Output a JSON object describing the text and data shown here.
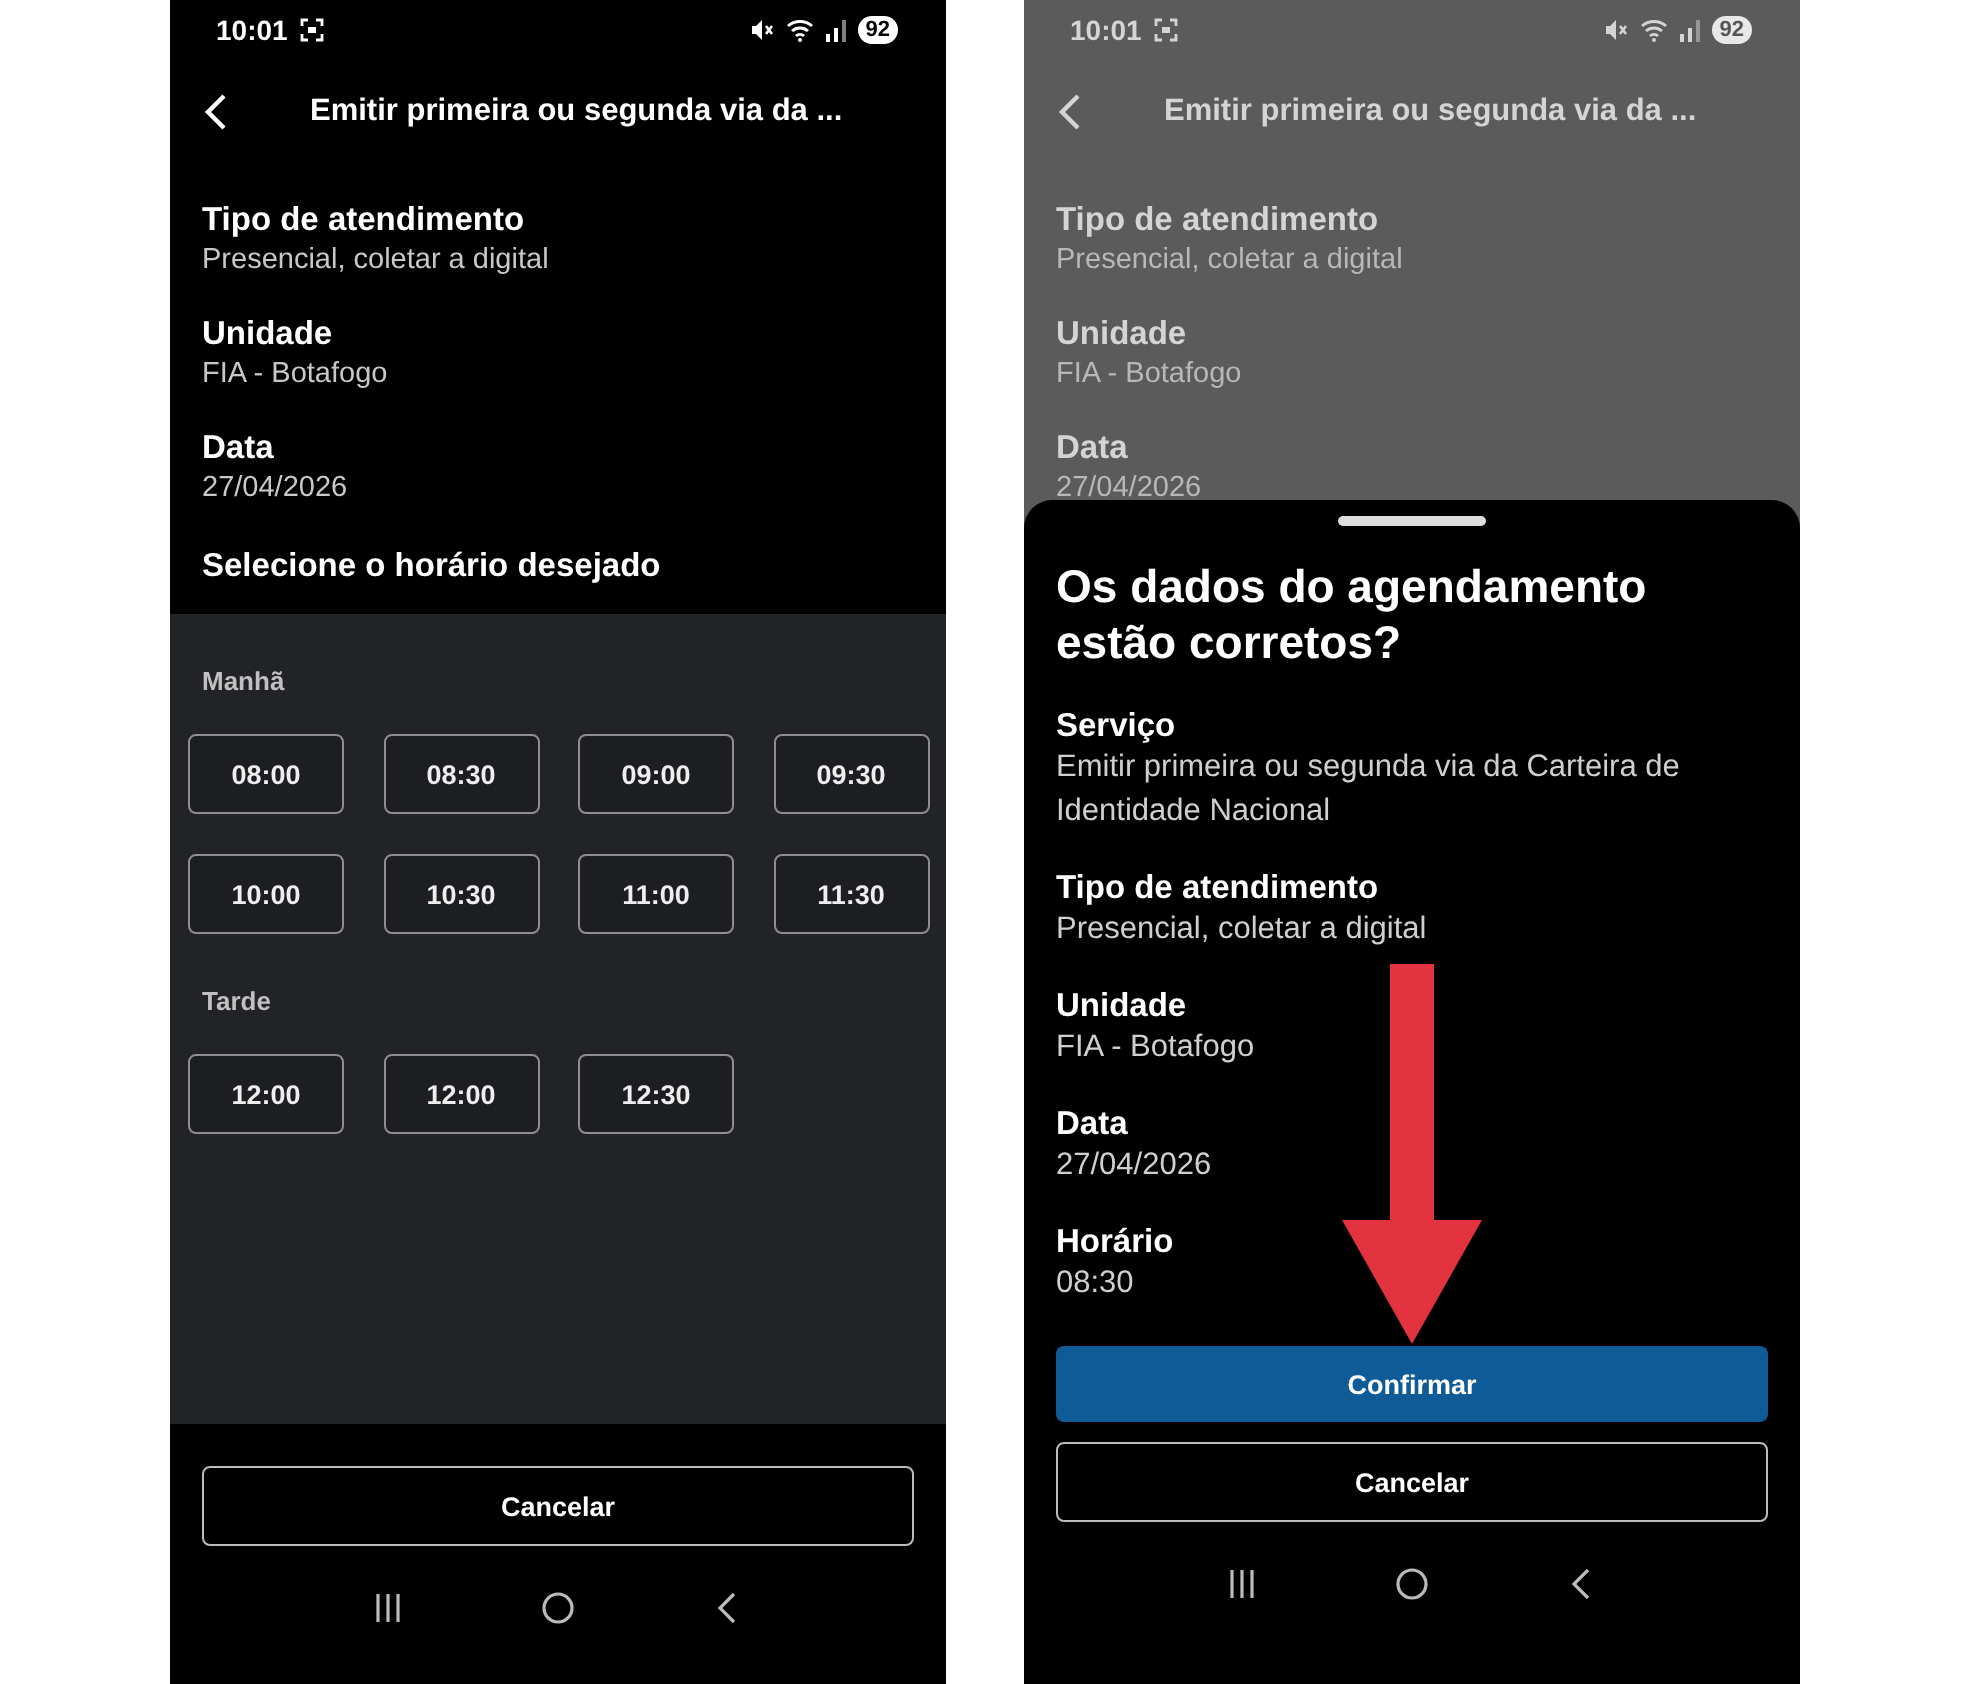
{
  "screens": [
    {
      "kind": "slots",
      "dimmed": false,
      "status_bar": {
        "time": "10:01",
        "battery": "92"
      },
      "header": {
        "title": "Emitir primeira ou segunda via da ..."
      },
      "fields": [
        {
          "label": "Tipo de atendimento",
          "value": "Presencial, coletar a digital"
        },
        {
          "label": "Unidade",
          "value": "FIA - Botafogo"
        },
        {
          "label": "Data",
          "value": "27/04/2026"
        }
      ],
      "prompt": "Selecione o horário desejado",
      "periods": [
        {
          "label": "Manhã",
          "slots": [
            "08:00",
            "08:30",
            "09:00",
            "09:30",
            "10:00",
            "10:30",
            "11:00",
            "11:30"
          ]
        },
        {
          "label": "Tarde",
          "slots": [
            "12:00",
            "12:00",
            "12:30"
          ]
        }
      ],
      "cancel_button": "Cancelar"
    },
    {
      "kind": "confirm",
      "dimmed": true,
      "status_bar": {
        "time": "10:01",
        "battery": "92"
      },
      "header": {
        "title": "Emitir primeira ou segunda via da ..."
      },
      "fields": [
        {
          "label": "Tipo de atendimento",
          "value": "Presencial, coletar a digital"
        },
        {
          "label": "Unidade",
          "value": "FIA - Botafogo"
        },
        {
          "label": "Data",
          "value": "27/04/2026"
        }
      ],
      "sheet": {
        "title": "Os dados do agendamento estão corretos?",
        "fields": [
          {
            "label": "Serviço",
            "value": "Emitir primeira ou segunda via da Carteira de Identidade Nacional"
          },
          {
            "label": "Tipo de atendimento",
            "value": "Presencial, coletar a digital"
          },
          {
            "label": "Unidade",
            "value": "FIA - Botafogo"
          },
          {
            "label": "Data",
            "value": "27/04/2026"
          },
          {
            "label": "Horário",
            "value": "08:30"
          }
        ],
        "confirm_button": "Confirmar",
        "cancel_button": "Cancelar"
      }
    }
  ]
}
